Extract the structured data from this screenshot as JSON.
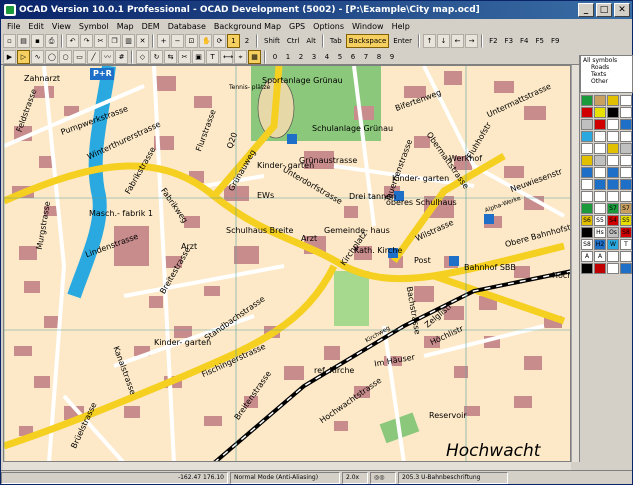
{
  "window": {
    "title": "OCAD Version 10.0.1  Professional - OCAD Development (5002) - [P:\\Example\\City map.ocd]",
    "minimize": "_",
    "maximize": "□",
    "close": "✕"
  },
  "menu": [
    "File",
    "Edit",
    "View",
    "Symbol",
    "Map",
    "DEM",
    "Database",
    "Background Map",
    "GPS",
    "Options",
    "Window",
    "Help"
  ],
  "toolbar1": {
    "keys": [
      "Shift",
      "Ctrl",
      "Alt",
      "Tab",
      "Backspace",
      "Enter"
    ],
    "fkeys": [
      "F2",
      "F3",
      "F4",
      "F5",
      "F9"
    ],
    "layer_buttons": [
      "1",
      "2"
    ]
  },
  "toolbar2": {
    "digits": [
      "0",
      "1",
      "2",
      "3",
      "4",
      "5",
      "6",
      "7",
      "8",
      "9"
    ]
  },
  "symbol_filter": [
    "All symbols",
    "Roads",
    "Texts",
    "Other"
  ],
  "map_labels": {
    "zahnarzt": "Zahnarzt",
    "pr": "P+R",
    "sportanlage": "Sportanlage\nGrünau",
    "tennisplatze": "Tennis-\nplätze",
    "schulanlage": "Schulanlage\nGrünau",
    "bifertenweg": "Bifertenweg",
    "unterhaltstrasse": "Untermattstrasse",
    "pumpwerkstrasse": "Pumpwerkstrasse",
    "feldstrasse": "Feldstrasse",
    "winterthurerstrasse": "Winterthurerstrasse",
    "flurstrasse": "Flurstrasse",
    "q20": "Q20",
    "grunaustrasse": "Grünaustrasse",
    "fluhhofstr": "Fluhhofstr",
    "werkhof": "Werkhof",
    "obermattstrasse": "Obermattstrasse",
    "neuwiesenstr": "Neuwiesenstr",
    "fabrikstrasse": "Fabrikstrasse",
    "grunauweg": "Grünauweg",
    "kindergarten1": "Kinder-\ngarten",
    "ews": "EWs",
    "unterdorfstrasse": "Unterdorfstrasse",
    "dreitannen": "Drei\ntannen",
    "tauernenstr": "Tauernenstrasse",
    "kindergarten2": "Kinder-\ngarten",
    "oberes_schulhaus": "oberes\nSchulhaus",
    "alpha_werke": "Alpha-Werke",
    "masch": "Masch.-\nfabrik 1",
    "fabrikweg": "Fabrikweg",
    "schulhaus_breite": "Schulhaus\nBreite",
    "gemeindehaus": "Gemeinde-\nhaus",
    "kath_kirche": "Kath.\nKirche",
    "post": "Post",
    "bahnhof": "Bahnhof SBB",
    "obere_bahnhofstr": "Obere Bahnhofstr",
    "wilstrasse": "Wilstrasse",
    "kirchplatz": "Kirchplatz",
    "lindenstrasse": "Lindenstrasse",
    "murgstrasse": "Murgstrasse",
    "arzt1": "Arzt",
    "arzt2": "Arzt",
    "breitestrasse": "Breitestrasse",
    "hochli": "Höchli",
    "standbachstrasse": "Standbachstrasse",
    "kindergarten3": "Kinder-\ngarten",
    "fischingerstrasse": "Fischingerstrasse",
    "kanalstrasse": "Kanalstrasse",
    "breitenstrasse": "Breitenstrasse",
    "ref_kirche": "ref. Kirche",
    "im_hauser": "Im Häuser",
    "zelglistr": "Zelglistr",
    "hochlistr": "Höchlistr",
    "bachstrasse": "Bachstrasse",
    "hochwachtstrasse": "Hochwachtstrasse",
    "bruelstrasse": "Brüelstrasse",
    "reservoir": "Reservoir",
    "hochwacht": "Hochwacht",
    "kirchweg": "Kirchweg"
  },
  "symbols": [
    "",
    "",
    "",
    "",
    "",
    "",
    "",
    "",
    "",
    "",
    "",
    "",
    "",
    "",
    "",
    "",
    "",
    "",
    "",
    "",
    "",
    "",
    "",
    "",
    "",
    "",
    "",
    "",
    "",
    "",
    "",
    "",
    "",
    "",
    "",
    "",
    "",
    "",
    "S7",
    "S7",
    "S6",
    "S5",
    "S4",
    "S5",
    "S7",
    "Hs",
    "Os",
    "S8",
    "S8",
    "H2",
    "W",
    "T",
    "A",
    "A",
    "",
    "",
    "",
    ""
  ],
  "status": {
    "coords": "-162.47    176.10",
    "mode": "Normal Mode (Anti-Aliasing)",
    "zoom": "2.0x",
    "symbol_info": "205.3 U-Bahnbeschriftung"
  },
  "colors": {
    "map_bg": "#fde9c7",
    "building": "#c98c8c",
    "main_road": "#f5d020",
    "water": "#29a9e0",
    "green": "#8cc87c",
    "railway": "#000000"
  }
}
